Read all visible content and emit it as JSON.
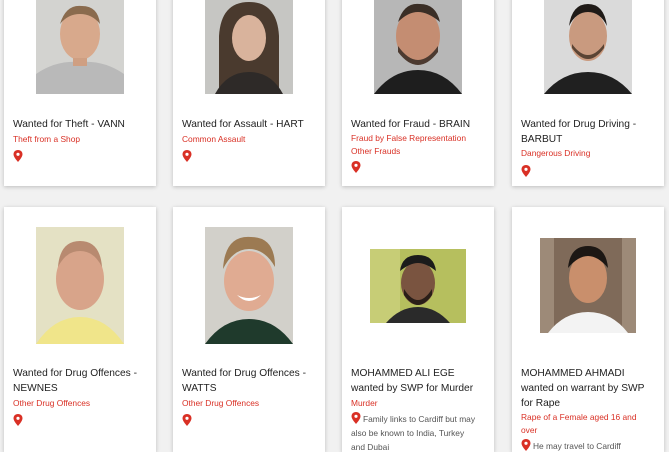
{
  "theme": {
    "accent": "#d93025",
    "card_bg": "#ffffff",
    "page_bg": "#f1f1f1"
  },
  "cards": [
    {
      "title": "Wanted for Theft - VANN",
      "offences": [
        "Theft from a Shop"
      ],
      "location": "",
      "pin_icon": "map-pin-icon"
    },
    {
      "title": "Wanted for Assault - HART",
      "offences": [
        "Common Assault"
      ],
      "location": "",
      "pin_icon": "map-pin-icon"
    },
    {
      "title": "Wanted for Fraud - BRAIN",
      "offences": [
        "Fraud by False Representation",
        "Other Frauds"
      ],
      "location": "",
      "pin_icon": "map-pin-icon"
    },
    {
      "title_line1": "Wanted for Drug Driving -",
      "title_line2": "BARBUT",
      "offences": [
        "Dangerous Driving"
      ],
      "location": "",
      "pin_icon": "map-pin-icon"
    },
    {
      "title_line1": "Wanted for Drug Offences -",
      "title_line2": "NEWNES",
      "offences": [
        "Other Drug Offences"
      ],
      "location": "",
      "pin_icon": "map-pin-icon"
    },
    {
      "title_line1": "Wanted for Drug Offences -",
      "title_line2": "WATTS",
      "offences": [
        "Other Drug Offences"
      ],
      "location": "",
      "pin_icon": "map-pin-icon"
    },
    {
      "title_line1": "MOHAMMED ALI EGE",
      "title_line2": "wanted by SWP for Murder",
      "offences": [
        "Murder"
      ],
      "location_lines": [
        "Family links to Cardiff but may",
        "also be known to India, Turkey",
        "and Dubai"
      ],
      "pin_icon": "map-pin-icon"
    },
    {
      "title_line1": "MOHAMMED AHMADI",
      "title_line2": "wanted on warrant by SWP",
      "title_line3": "for Rape",
      "offences": [
        "Rape of a Female aged 16 and",
        "over"
      ],
      "location_lines": [
        "He may travel to Cardiff"
      ],
      "pin_icon": "map-pin-icon"
    }
  ]
}
